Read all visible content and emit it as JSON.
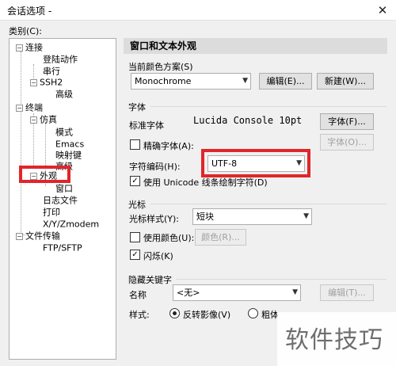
{
  "window": {
    "title": "会话选项 -",
    "close_glyph": "✕"
  },
  "category_label": "类别(C):",
  "tree": [
    {
      "label": "连接",
      "expander": "−"
    },
    {
      "label": "登陆动作"
    },
    {
      "label": "串行"
    },
    {
      "label": "SSH2",
      "expander": "−"
    },
    {
      "label": "高级"
    },
    {
      "label": "终端",
      "expander": "−"
    },
    {
      "label": "仿真",
      "expander": "−"
    },
    {
      "label": "模式"
    },
    {
      "label": "Emacs"
    },
    {
      "label": "映射键"
    },
    {
      "label": "高级"
    },
    {
      "label": "外观",
      "expander": "−",
      "selected": true
    },
    {
      "label": "窗口"
    },
    {
      "label": "日志文件"
    },
    {
      "label": "打印"
    },
    {
      "label": "X/Y/Zmodem"
    },
    {
      "label": "文件传输",
      "expander": "−"
    },
    {
      "label": "FTP/SFTP"
    }
  ],
  "panel": {
    "title": "窗口和文本外观",
    "scheme": {
      "group_label": "当前颜色方案(S)",
      "value": "Monochrome",
      "edit_button": "编辑(E)...",
      "new_button": "新建(W)..."
    },
    "font": {
      "group_label": "字体",
      "standard_label": "标准字体",
      "standard_value": "Lucida Console 10pt",
      "font_button": "字体(F)...",
      "precise_label": "精确字体(A):",
      "precise_checked": false,
      "precise_button": "字体(O)...",
      "encoding_label": "字符编码(H):",
      "encoding_value": "UTF-8",
      "unicode_label": "使用 Unicode 线条绘制字符(D)",
      "unicode_checked": true
    },
    "cursor": {
      "group_label": "光标",
      "style_label": "光标样式(Y):",
      "style_value": "短块",
      "use_color_label": "使用颜色(U):",
      "use_color_checked": false,
      "color_button": "颜色(R)...",
      "blink_label": "闪烁(K)",
      "blink_checked": true
    },
    "hidden_keyword": {
      "group_label": "隐藏关键字",
      "name_label": "名称",
      "name_value": "<无>",
      "edit_button": "编辑(T)...",
      "style_label": "样式:",
      "option_reverse": "反转影像(V)",
      "option_bold": "粗体",
      "selected": "reverse"
    }
  },
  "watermark": "软件技巧",
  "check_glyph": "✓",
  "dropdown_glyph": "▼",
  "colors": {
    "highlight": "#e0262a",
    "header_bg": "#dcdcdc"
  }
}
